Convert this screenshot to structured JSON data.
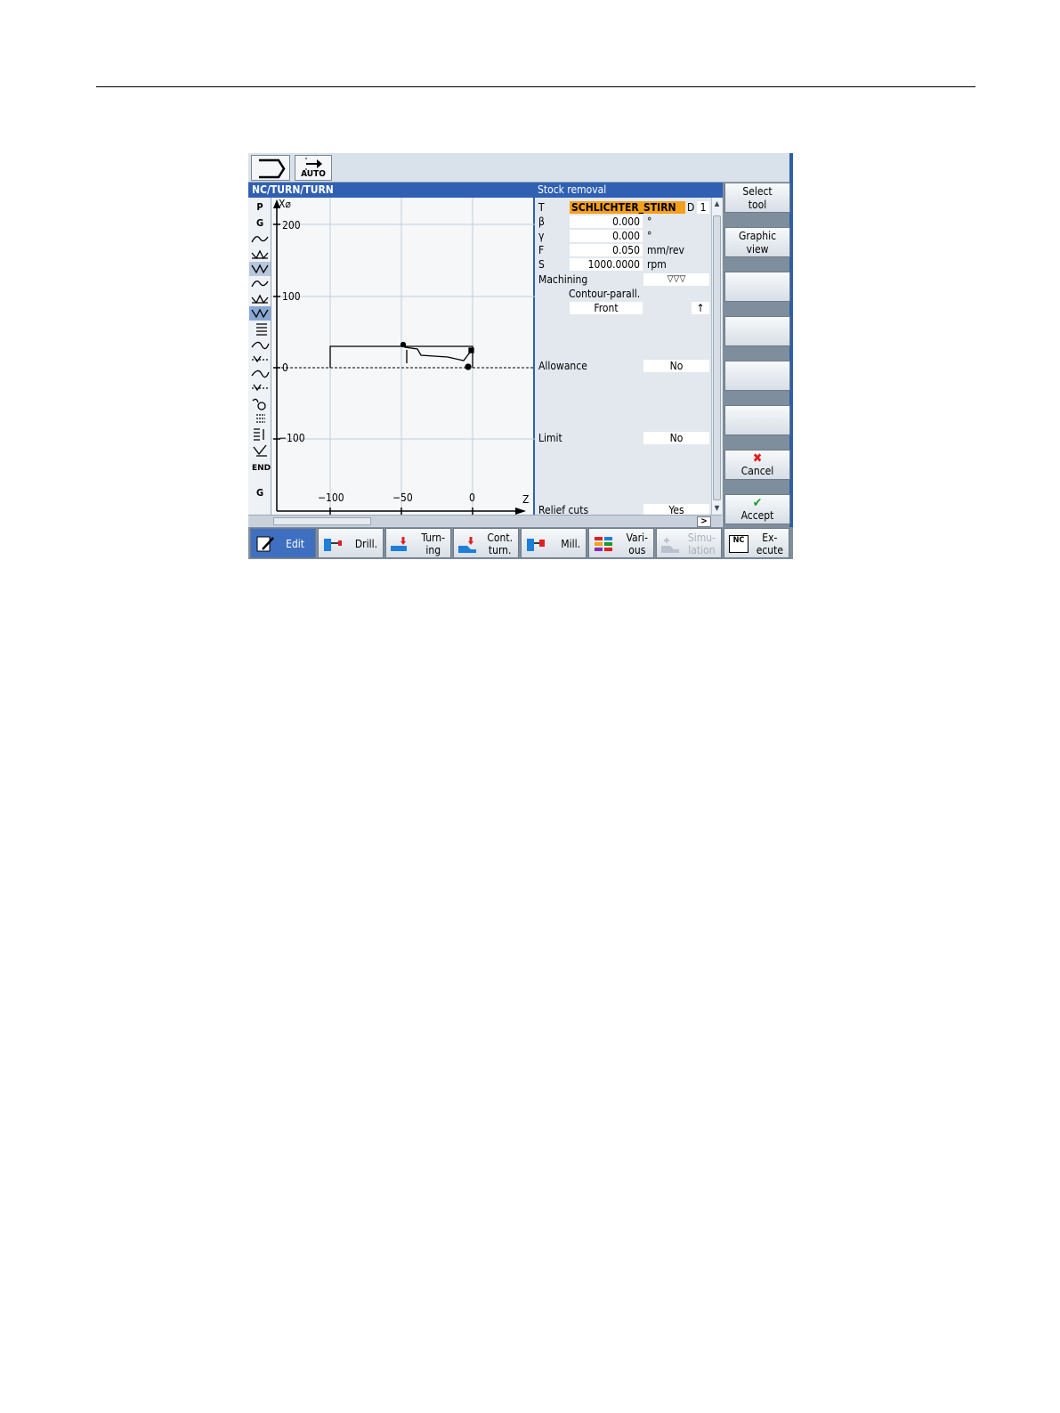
{
  "topbar": {
    "auto_label": "AUTO"
  },
  "header": {
    "path": "NC/TURN/TURN",
    "param_title": "Stock removal"
  },
  "gstrip": {
    "items": [
      "P",
      "G",
      "G"
    ]
  },
  "graphic": {
    "axis_x_label": "X⌀",
    "axis_z_label": "Z",
    "x_ticks": [
      "200",
      "100",
      "0",
      "−100"
    ],
    "z_ticks": [
      "−100",
      "−50",
      "0"
    ]
  },
  "params": {
    "tool": {
      "label": "T",
      "value": "SCHLICHTER_STIRN",
      "d_label": "D",
      "d_value": "1"
    },
    "beta": {
      "label": "β",
      "value": "0.000",
      "unit": "°"
    },
    "gamma": {
      "label": "γ",
      "value": "0.000",
      "unit": "°"
    },
    "feed": {
      "label": "F",
      "value": "0.050",
      "unit": "mm/rev"
    },
    "speed": {
      "label": "S",
      "value": "1000.0000",
      "unit": "rpm"
    },
    "machining": {
      "label": "Machining",
      "value": "▽▽▽",
      "mode": "Contour-parall.",
      "direction": "Front",
      "arrow": "↑"
    },
    "allowance": {
      "label": "Allowance",
      "value": "No"
    },
    "limit": {
      "label": "Limit",
      "value": "No"
    },
    "relief": {
      "label": "Relief cuts",
      "value": "Yes"
    }
  },
  "hscroll": {
    "arrow": ">"
  },
  "vertical_softkeys": [
    {
      "line1": "Select",
      "line2": "tool"
    },
    {
      "line1": "Graphic",
      "line2": "view"
    },
    {
      "line1": "",
      "line2": ""
    },
    {
      "line1": "",
      "line2": ""
    },
    {
      "line1": "",
      "line2": ""
    },
    {
      "line1": "",
      "line2": ""
    },
    {
      "icon": "✖",
      "line1": "Cancel"
    },
    {
      "icon": "✔",
      "line1": "Accept"
    }
  ],
  "horizontal_softkeys": [
    {
      "line1": "Edit",
      "line2": ""
    },
    {
      "line1": "Drill.",
      "line2": ""
    },
    {
      "line1": "Turn-",
      "line2": "ing"
    },
    {
      "line1": "Cont.",
      "line2": "turn."
    },
    {
      "line1": "Mill.",
      "line2": ""
    },
    {
      "line1": "Vari-",
      "line2": "ous"
    },
    {
      "line1": "Simu-",
      "line2": "lation"
    },
    {
      "line1": "Ex-",
      "line2": "ecute",
      "icon_text": "NC"
    }
  ],
  "colors": {
    "title_bar": "#3060b4",
    "highlight": "#f5a01a",
    "cancel": "#e02020",
    "accept": "#1a9a2a"
  }
}
